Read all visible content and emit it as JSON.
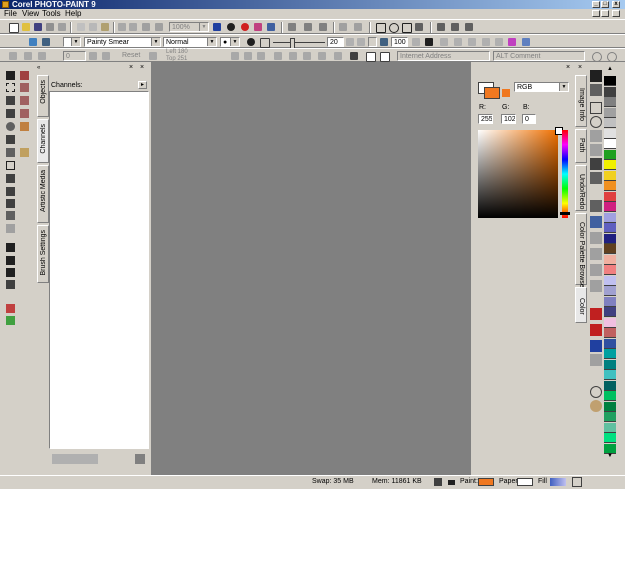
{
  "window": {
    "title": "Corel PHOTO-PAINT 9",
    "buttons": [
      "_",
      "□",
      "x"
    ]
  },
  "menu": [
    {
      "label": "File"
    },
    {
      "label": "View"
    },
    {
      "label": "Tools"
    },
    {
      "label": "Help"
    }
  ],
  "standard_toolbar": {
    "zoom_value": "100%"
  },
  "property_bar": {
    "brush_type": "Painty Smear",
    "merge_mode": "Normal",
    "nib_size": "20",
    "transparency": "100",
    "amount": "0"
  },
  "third_bar": {
    "reset_label": "Reset",
    "left_field": "Left 180",
    "top_field": "Top 251",
    "internet_address_placeholder": "Internet Address",
    "alt_comment_placeholder": "ALT Comment"
  },
  "left_docker": {
    "header": "Channels:",
    "tabs": [
      "Objects",
      "Channels",
      "Artistic Media",
      "Brush Settings"
    ]
  },
  "color_docker": {
    "model": "RGB",
    "r_label": "R:",
    "g_label": "G:",
    "b_label": "B:",
    "r_value": "255",
    "g_value": "102",
    "b_value": "0",
    "tabs": [
      "Image Info",
      "Path",
      "Undo/Redo",
      "Color Palette Browser",
      "Color"
    ]
  },
  "status_bar": {
    "swap": "Swap: 35 MB",
    "mem": "Mem: 11861 KB",
    "paint_label": "Paint:",
    "paper_label": "Paper:",
    "fill_label": "Fill"
  },
  "colors": {
    "paint": "#f07820",
    "paper": "#ffffff",
    "workspace": "#808080",
    "chrome": "#d4d0c8",
    "title_start": "#0a246a",
    "title_end": "#a6caf0"
  },
  "palette_swatches": [
    "#000000",
    "#404040",
    "#808080",
    "#a0a0a0",
    "#c0c0c0",
    "#e0e0e0",
    "#ffffff",
    "#20a020",
    "#f0f000",
    "#f0d020",
    "#f09020",
    "#e04040",
    "#d02080",
    "#a0a0e0",
    "#6060c0",
    "#202080",
    "#604020",
    "#f0b0a0",
    "#f08080",
    "#c0c0f0",
    "#a0a0d0",
    "#8080c0",
    "#404080",
    "#f0c0e0",
    "#c06060",
    "#3050a0",
    "#00a0a0",
    "#008080",
    "#40c0c0",
    "#006060",
    "#00c060",
    "#008040",
    "#20a060",
    "#60c0a0",
    "#00e080",
    "#00a040"
  ]
}
